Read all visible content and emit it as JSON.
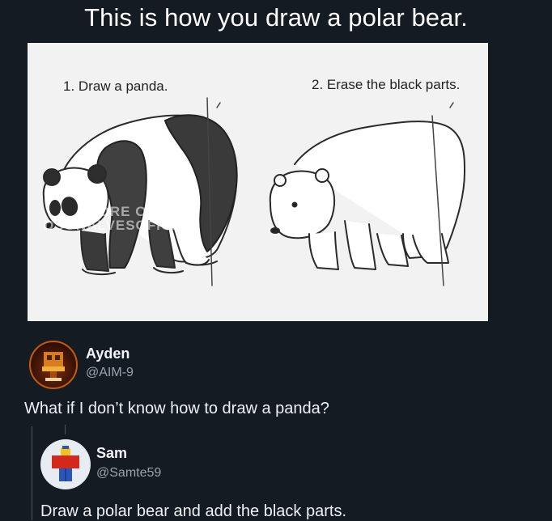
{
  "post": {
    "title": "This is how you draw a polar bear."
  },
  "illustration": {
    "step1_label": "1. Draw a panda.",
    "step2_label": "2. Erase the black parts.",
    "watermark_line1": "CORE   O:",
    "watermark_line2": "DSONALVESOFICIAL"
  },
  "replies": [
    {
      "name": "Ayden",
      "handle": "@AIM-9",
      "text": "What if I don’t know how to draw a panda?"
    },
    {
      "name": "Sam",
      "handle": "@Samte59",
      "text": "Draw a polar bear and add the black parts."
    }
  ],
  "colors": {
    "background": "#151b23",
    "text": "#e9edf2",
    "handle": "#9aa3ae",
    "ayden_avatar_accent": "#c45a10",
    "sam_avatar_shirt": "#d4281c",
    "sam_avatar_pants": "#2b56b8"
  }
}
